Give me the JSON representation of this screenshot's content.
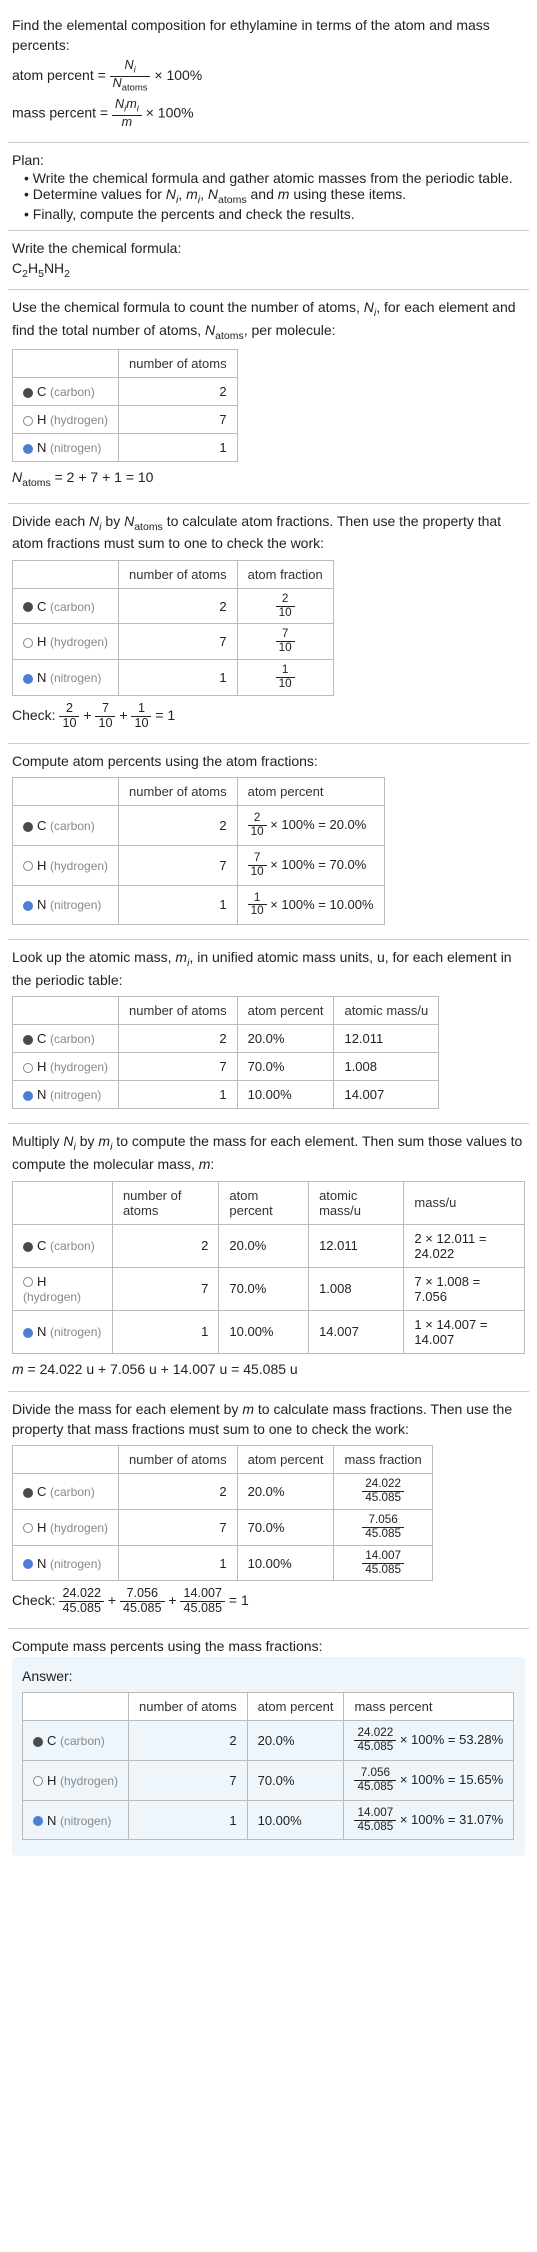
{
  "intro": {
    "l1": "Find the elemental composition for ethylamine in terms of the atom and mass percents:",
    "atom_percent_lhs": "atom percent = ",
    "mass_percent_lhs": "mass percent = ",
    "times100": " × 100%"
  },
  "plan": {
    "heading": "Plan:",
    "b1": "Write the chemical formula and gather atomic masses from the periodic table.",
    "b2_a": "Determine values for ",
    "b2_b": " using these items.",
    "b3": "Finally, compute the percents and check the results."
  },
  "write_formula": {
    "text": "Write the chemical formula:"
  },
  "count_atoms": {
    "p1a": "Use the chemical formula to count the number of atoms, ",
    "p1b": ", for each element and find the total number of atoms, ",
    "p1c": ", per molecule:",
    "hdr_num": "number of atoms",
    "rows": [
      {
        "el": "C",
        "name": "(carbon)",
        "n": "2"
      },
      {
        "el": "H",
        "name": "(hydrogen)",
        "n": "7"
      },
      {
        "el": "N",
        "name": "(nitrogen)",
        "n": "1"
      }
    ],
    "eq": " = 2 + 7 + 1 = 10"
  },
  "atom_frac": {
    "p1a": "Divide each ",
    "p1b": " by ",
    "p1c": " to calculate atom fractions. Then use the property that atom fractions must sum to one to check the work:",
    "hdr_num": "number of atoms",
    "hdr_frac": "atom fraction",
    "rows": [
      {
        "el": "C",
        "name": "(carbon)",
        "n": "2",
        "fn": "2",
        "fd": "10"
      },
      {
        "el": "H",
        "name": "(hydrogen)",
        "n": "7",
        "fn": "7",
        "fd": "10"
      },
      {
        "el": "N",
        "name": "(nitrogen)",
        "n": "1",
        "fn": "1",
        "fd": "10"
      }
    ],
    "check_label": "Check: ",
    "check_eq": " = 1"
  },
  "atom_pct": {
    "p": "Compute atom percents using the atom fractions:",
    "hdr_num": "number of atoms",
    "hdr_pct": "atom percent",
    "rows": [
      {
        "el": "C",
        "name": "(carbon)",
        "n": "2",
        "fn": "2",
        "fd": "10",
        "res": " × 100% = 20.0%"
      },
      {
        "el": "H",
        "name": "(hydrogen)",
        "n": "7",
        "fn": "7",
        "fd": "10",
        "res": " × 100% = 70.0%"
      },
      {
        "el": "N",
        "name": "(nitrogen)",
        "n": "1",
        "fn": "1",
        "fd": "10",
        "res": " × 100% = 10.00%"
      }
    ]
  },
  "atomic_mass": {
    "p1a": "Look up the atomic mass, ",
    "p1b": ", in unified atomic mass units, u, for each element in the periodic table:",
    "hdr_num": "number of atoms",
    "hdr_pct": "atom percent",
    "hdr_amu": "atomic mass/u",
    "rows": [
      {
        "el": "C",
        "name": "(carbon)",
        "n": "2",
        "pct": "20.0%",
        "amu": "12.011"
      },
      {
        "el": "H",
        "name": "(hydrogen)",
        "n": "7",
        "pct": "70.0%",
        "amu": "1.008"
      },
      {
        "el": "N",
        "name": "(nitrogen)",
        "n": "1",
        "pct": "10.00%",
        "amu": "14.007"
      }
    ]
  },
  "mass_calc": {
    "p1a": "Multiply ",
    "p1b": " by ",
    "p1c": " to compute the mass for each element. Then sum those values to compute the molecular mass, ",
    "p1d": ":",
    "hdr_num": "number of atoms",
    "hdr_pct": "atom percent",
    "hdr_amu": "atomic mass/u",
    "hdr_mass": "mass/u",
    "rows": [
      {
        "el": "C",
        "name": "(carbon)",
        "n": "2",
        "pct": "20.0%",
        "amu": "12.011",
        "calc": "2 × 12.011 = 24.022"
      },
      {
        "el": "H",
        "name": "(hydrogen)",
        "n": "7",
        "pct": "70.0%",
        "amu": "1.008",
        "calc": "7 × 1.008 = 7.056"
      },
      {
        "el": "N",
        "name": "(nitrogen)",
        "n": "1",
        "pct": "10.00%",
        "amu": "14.007",
        "calc": "1 × 14.007 = 14.007"
      }
    ],
    "eq": " = 24.022 u + 7.056 u + 14.007 u = 45.085 u"
  },
  "mass_frac": {
    "p1a": "Divide the mass for each element by ",
    "p1b": " to calculate mass fractions. Then use the property that mass fractions must sum to one to check the work:",
    "hdr_num": "number of atoms",
    "hdr_pct": "atom percent",
    "hdr_mfrac": "mass fraction",
    "rows": [
      {
        "el": "C",
        "name": "(carbon)",
        "n": "2",
        "pct": "20.0%",
        "fn": "24.022",
        "fd": "45.085"
      },
      {
        "el": "H",
        "name": "(hydrogen)",
        "n": "7",
        "pct": "70.0%",
        "fn": "7.056",
        "fd": "45.085"
      },
      {
        "el": "N",
        "name": "(nitrogen)",
        "n": "1",
        "pct": "10.00%",
        "fn": "14.007",
        "fd": "45.085"
      }
    ],
    "check_label": "Check: ",
    "check_eq": " = 1"
  },
  "mass_pct_line": "Compute mass percents using the mass fractions:",
  "answer": {
    "label": "Answer:",
    "hdr_num": "number of atoms",
    "hdr_pct": "atom percent",
    "hdr_mpct": "mass percent",
    "rows": [
      {
        "el": "C",
        "name": "(carbon)",
        "n": "2",
        "pct": "20.0%",
        "fn": "24.022",
        "fd": "45.085",
        "res": " × 100% = 53.28%"
      },
      {
        "el": "H",
        "name": "(hydrogen)",
        "n": "7",
        "pct": "70.0%",
        "fn": "7.056",
        "fd": "45.085",
        "res": " × 100% = 15.65%"
      },
      {
        "el": "N",
        "name": "(nitrogen)",
        "n": "1",
        "pct": "10.00%",
        "fn": "14.007",
        "fd": "45.085",
        "res": " × 100% = 31.07%"
      }
    ]
  }
}
